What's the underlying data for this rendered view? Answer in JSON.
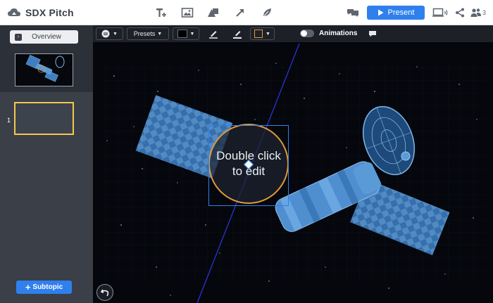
{
  "app": {
    "title": "SDX Pitch",
    "colors": {
      "accent": "#2f80ed",
      "selection": "#f2c94c",
      "circle_border": "#e09a3c"
    }
  },
  "toolbar": {
    "icons": [
      "text-tool-icon",
      "image-tool-icon",
      "shape-tool-icon",
      "arrow-tool-icon",
      "leaf-tool-icon"
    ],
    "present_label": "Present",
    "right_icons": [
      "comment-icon",
      "device-preview-icon",
      "share-icon",
      "collaborators-icon"
    ],
    "collaborator_count": "3"
  },
  "sidebar": {
    "overview_label": "Overview",
    "slide_number": "1",
    "subtopic_label": "Subtopic",
    "subtopic_prefix": "+"
  },
  "canvas_toolbar": {
    "presets_label": "Presets",
    "fill_color": "#000000",
    "border_color": "#e09a3c",
    "animations_label": "Animations",
    "animations_on": false
  },
  "canvas": {
    "placeholder_line1": "Double click",
    "placeholder_line2": "to edit"
  }
}
